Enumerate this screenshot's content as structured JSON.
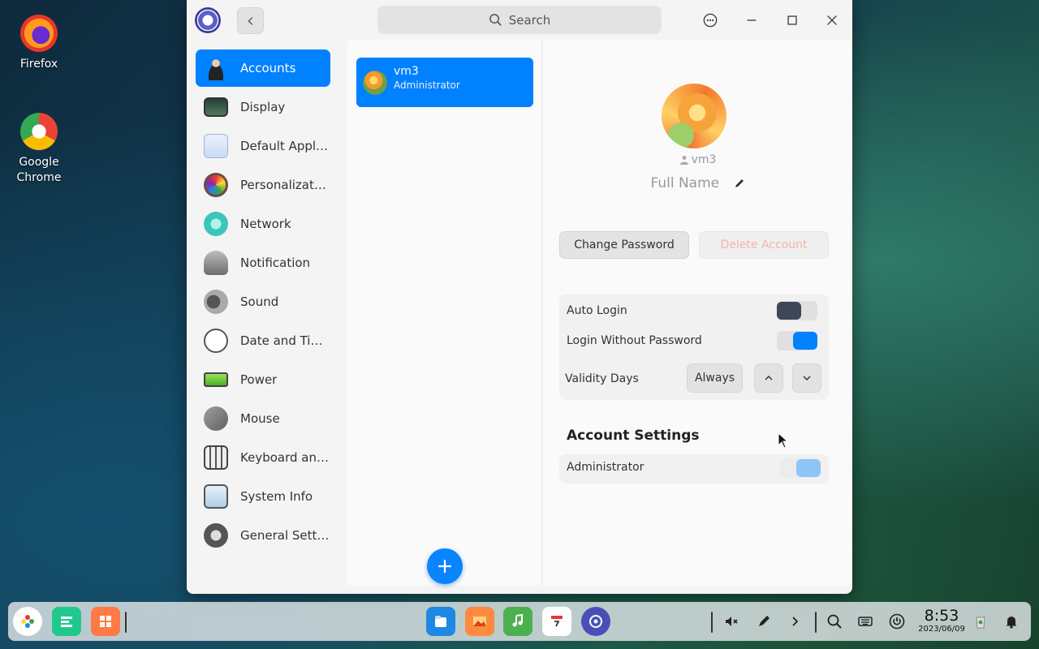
{
  "desktop": {
    "icons": [
      {
        "label": "Firefox",
        "icon": "firefox-icon"
      },
      {
        "label": "Google Chrome",
        "icon": "chrome-icon"
      }
    ]
  },
  "window": {
    "search_placeholder": "Search",
    "sidebar": [
      {
        "label": "Accounts",
        "icon": "accounts-icon",
        "active": true
      },
      {
        "label": "Display",
        "icon": "display-icon"
      },
      {
        "label": "Default Applic...",
        "icon": "default-applications-icon"
      },
      {
        "label": "Personalization",
        "icon": "personalization-icon"
      },
      {
        "label": "Network",
        "icon": "network-icon"
      },
      {
        "label": "Notification",
        "icon": "notification-icon"
      },
      {
        "label": "Sound",
        "icon": "sound-icon"
      },
      {
        "label": "Date and Time",
        "icon": "date-time-icon"
      },
      {
        "label": "Power",
        "icon": "power-icon"
      },
      {
        "label": "Mouse",
        "icon": "mouse-icon"
      },
      {
        "label": "Keyboard and ...",
        "icon": "keyboard-icon"
      },
      {
        "label": "System Info",
        "icon": "system-info-icon"
      },
      {
        "label": "General Settin...",
        "icon": "general-settings-icon"
      }
    ],
    "users": [
      {
        "name": "vm3",
        "role": "Administrator"
      }
    ],
    "detail": {
      "username": "vm3",
      "full_name_placeholder": "Full Name",
      "change_password": "Change Password",
      "delete_account": "Delete Account",
      "auto_login": {
        "label": "Auto Login",
        "on": false
      },
      "login_without_password": {
        "label": "Login Without Password",
        "on": true
      },
      "validity_days": {
        "label": "Validity Days",
        "value": "Always"
      },
      "account_settings_title": "Account Settings",
      "administrator": {
        "label": "Administrator",
        "on": true
      }
    }
  },
  "taskbar": {
    "time": "8:53",
    "date": "2023/06/09"
  },
  "colors": {
    "accent": "#0081ff",
    "toggle_off_knob": "#3d4759",
    "admin_toggle": "#8fc4f7",
    "delete_text": "#f4b3a8"
  }
}
